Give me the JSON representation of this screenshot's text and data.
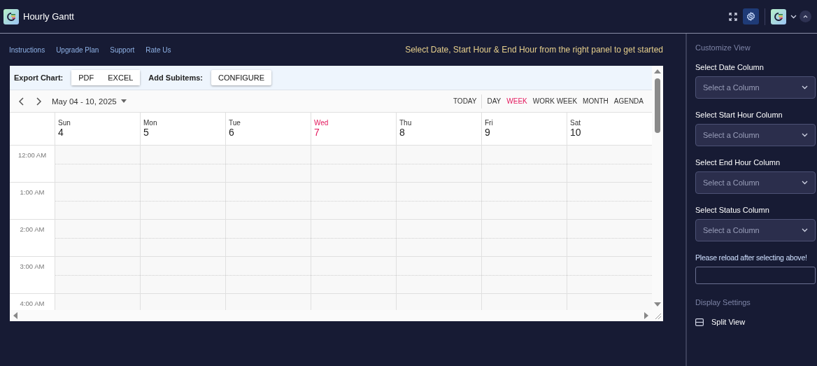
{
  "app": {
    "title": "Hourly Gantt"
  },
  "links": [
    "Instructions",
    "Upgrade Plan",
    "Support",
    "Rate Us"
  ],
  "banner": "Select Date, Start Hour & End Hour from the right panel to get started",
  "toolbar": {
    "export_label": "Export Chart:",
    "export_buttons": [
      "PDF",
      "EXCEL"
    ],
    "subitems_label": "Add Subitems:",
    "configure_button": "CONFIGURE"
  },
  "calendar": {
    "date_range": "May 04 - 10, 2025",
    "today_button": "TODAY",
    "views": [
      {
        "label": "DAY",
        "selected": false
      },
      {
        "label": "WEEK",
        "selected": true
      },
      {
        "label": "WORK WEEK",
        "selected": false
      },
      {
        "label": "MONTH",
        "selected": false
      },
      {
        "label": "AGENDA",
        "selected": false
      }
    ],
    "days": [
      {
        "name": "Sun",
        "date": "4",
        "today": false
      },
      {
        "name": "Mon",
        "date": "5",
        "today": false
      },
      {
        "name": "Tue",
        "date": "6",
        "today": false
      },
      {
        "name": "Wed",
        "date": "7",
        "today": true
      },
      {
        "name": "Thu",
        "date": "8",
        "today": false
      },
      {
        "name": "Fri",
        "date": "9",
        "today": false
      },
      {
        "name": "Sat",
        "date": "10",
        "today": false
      }
    ],
    "hours": [
      "12:00 AM",
      "1:00 AM",
      "2:00 AM",
      "3:00 AM",
      "4:00 AM"
    ]
  },
  "panel": {
    "title": "Customize View",
    "selects": [
      {
        "label": "Select Date Column",
        "placeholder": "Select a Column"
      },
      {
        "label": "Select Start Hour Column",
        "placeholder": "Select a Column"
      },
      {
        "label": "Select End Hour Column",
        "placeholder": "Select a Column"
      },
      {
        "label": "Select Status Column",
        "placeholder": "Select a Column"
      }
    ],
    "reload_note": "Please reload after selecting above!",
    "display_title": "Display Settings",
    "split_view": "Split View"
  }
}
